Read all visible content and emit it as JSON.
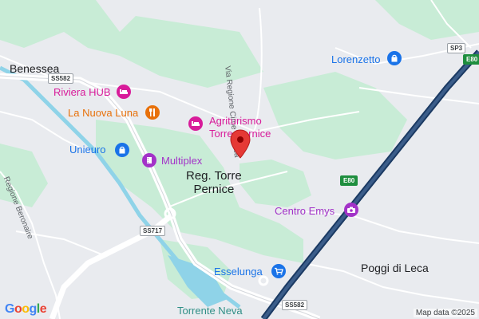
{
  "map": {
    "colors": {
      "land": "#e9ebef",
      "green": "#c8ecd6",
      "highway": "#2f4f7a",
      "road": "#ffffff",
      "water": "#8fd3e8",
      "pin": "#e53935"
    },
    "places": {
      "benessea": "Benessea",
      "torre_pernice_line1": "Reg. Torre",
      "torre_pernice_line2": "Pernice",
      "poggi": "Poggi di Leca"
    },
    "pois": {
      "riviera_hub": {
        "label": "Riviera HUB",
        "icon": "hotel-icon"
      },
      "la_nuova_luna": {
        "label": "La Nuova Luna",
        "icon": "restaurant-icon"
      },
      "agriturismo_line1": "Agriturismo",
      "agriturismo_line2": "Torre Pernice",
      "agriturismo_icon": "hotel-icon",
      "unieuro": {
        "label": "Unieuro",
        "icon": "shopping-bag-icon"
      },
      "multiplex": {
        "label": "Multiplex",
        "icon": "cinema-icon"
      },
      "lorenzetto": {
        "label": "Lorenzetto",
        "icon": "shopping-bag-icon"
      },
      "centro_emys": {
        "label": "Centro Emys",
        "icon": "camera-icon"
      },
      "esselunga": {
        "label": "Esselunga",
        "icon": "shopping-cart-icon"
      },
      "torrente_neva": "Torrente Neva"
    },
    "roads": {
      "via_regione": "Via Regione Cime di Leca",
      "regione_beronaire": "Regione Beronaire"
    },
    "shields": {
      "ss582_top": "SS582",
      "sp3": "SP3",
      "e80_right": "E80",
      "e80_mid": "E80",
      "ss717": "SS717",
      "ss582_bottom": "SS582"
    },
    "logo": "Google",
    "attribution": "Map data ©2025"
  }
}
